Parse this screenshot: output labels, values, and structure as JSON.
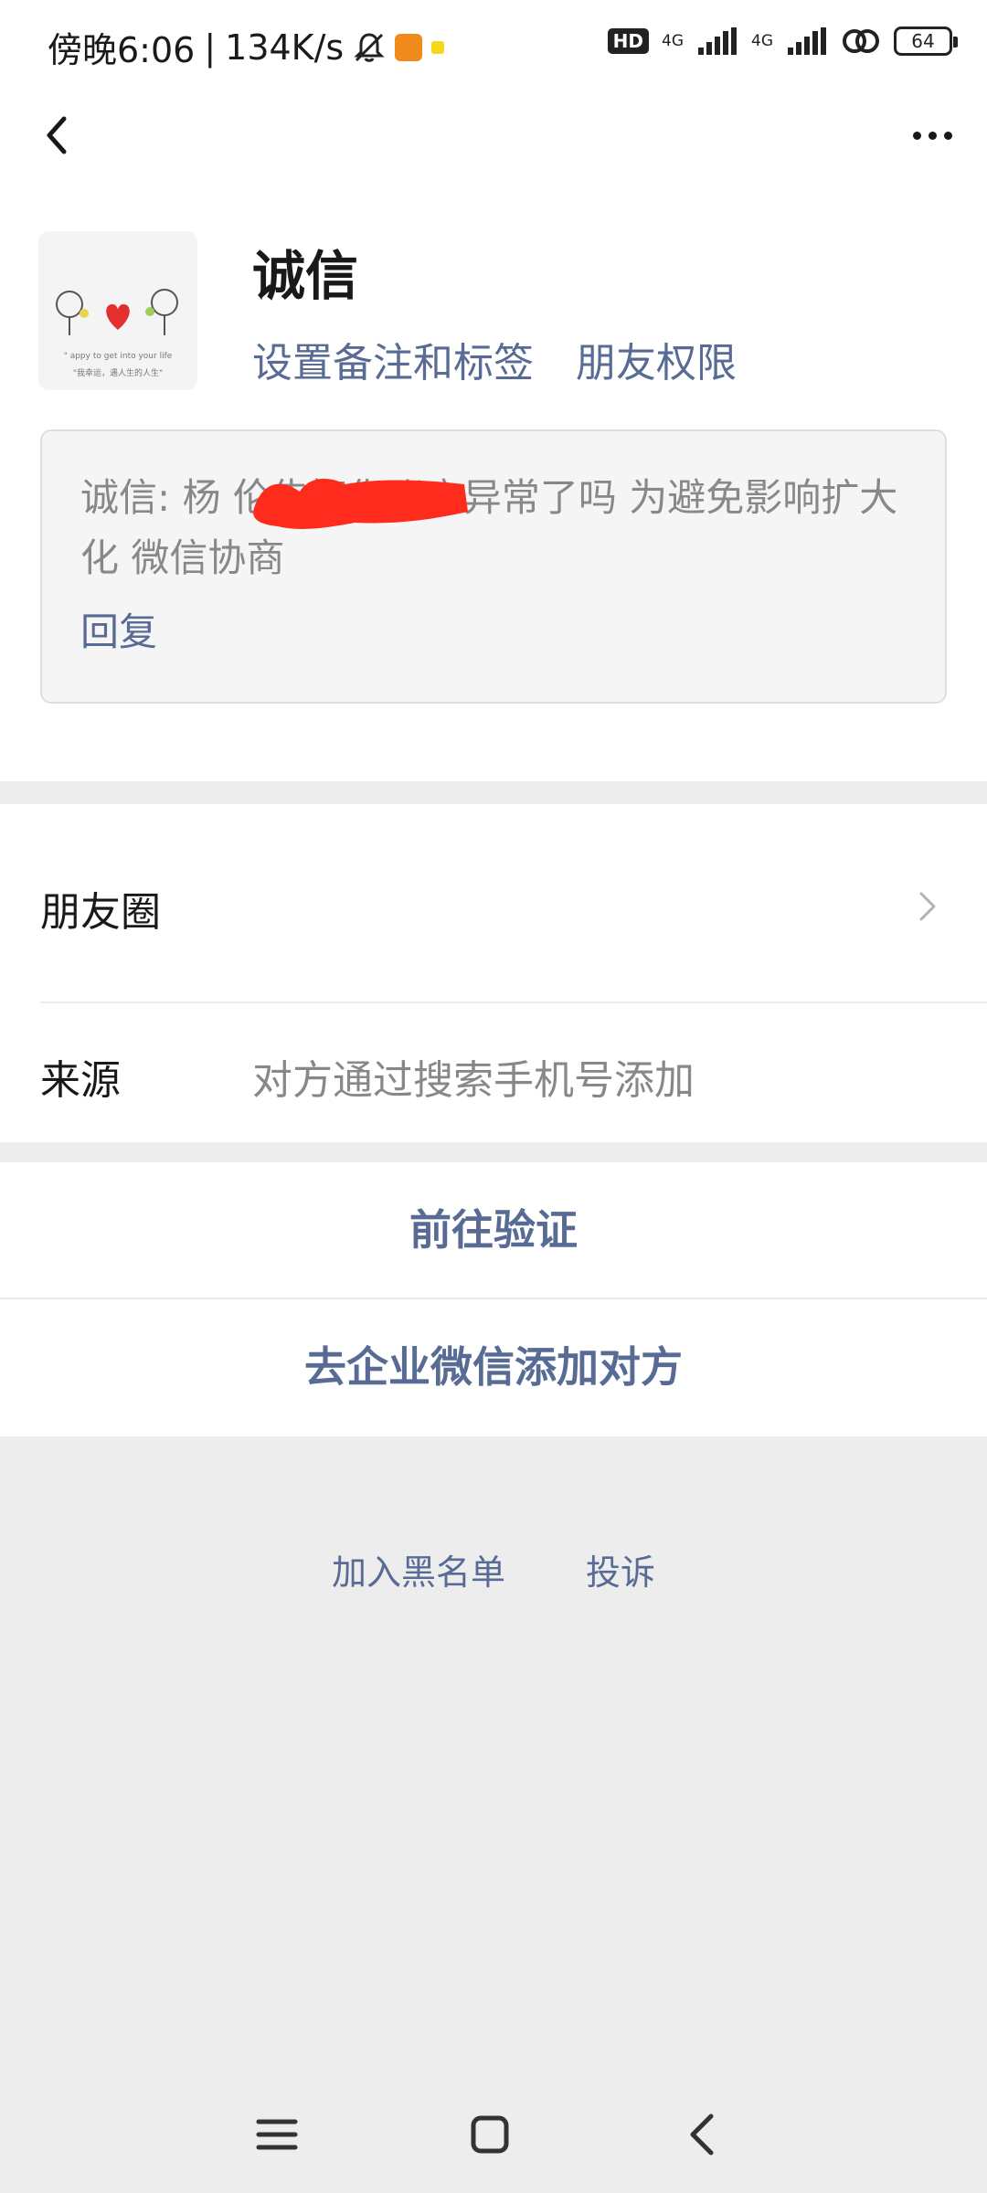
{
  "status_bar": {
    "time": "傍晚6:06",
    "speed": "134K/s",
    "hd": "HD",
    "network": "4G",
    "network2": "4G",
    "battery": "64"
  },
  "nav": {
    "back_icon": "chevron-left-icon",
    "more_icon": "more-dots-icon"
  },
  "profile": {
    "name": "诚信",
    "set_remark_label": "设置备注和标签",
    "friend_permission_label": "朋友权限",
    "avatar_caption_1": "\" appy to get into your life",
    "avatar_caption_2": "\"我幸运，遇人生的人生\""
  },
  "message": {
    "text": "诚信: 杨                  伦告知你账户异常了吗 为避免影响扩大化 微信协商",
    "reply_label": "回复"
  },
  "rows": {
    "moments_label": "朋友圈",
    "source_label": "来源",
    "source_value": "对方通过搜索手机号添加"
  },
  "actions": {
    "verify": "前往验证",
    "enterprise_add": "去企业微信添加对方"
  },
  "footer": {
    "blacklist": "加入黑名单",
    "report": "投诉"
  },
  "colors": {
    "link": "#576b95",
    "background": "#ededed",
    "redaction": "#ff2b1c"
  }
}
